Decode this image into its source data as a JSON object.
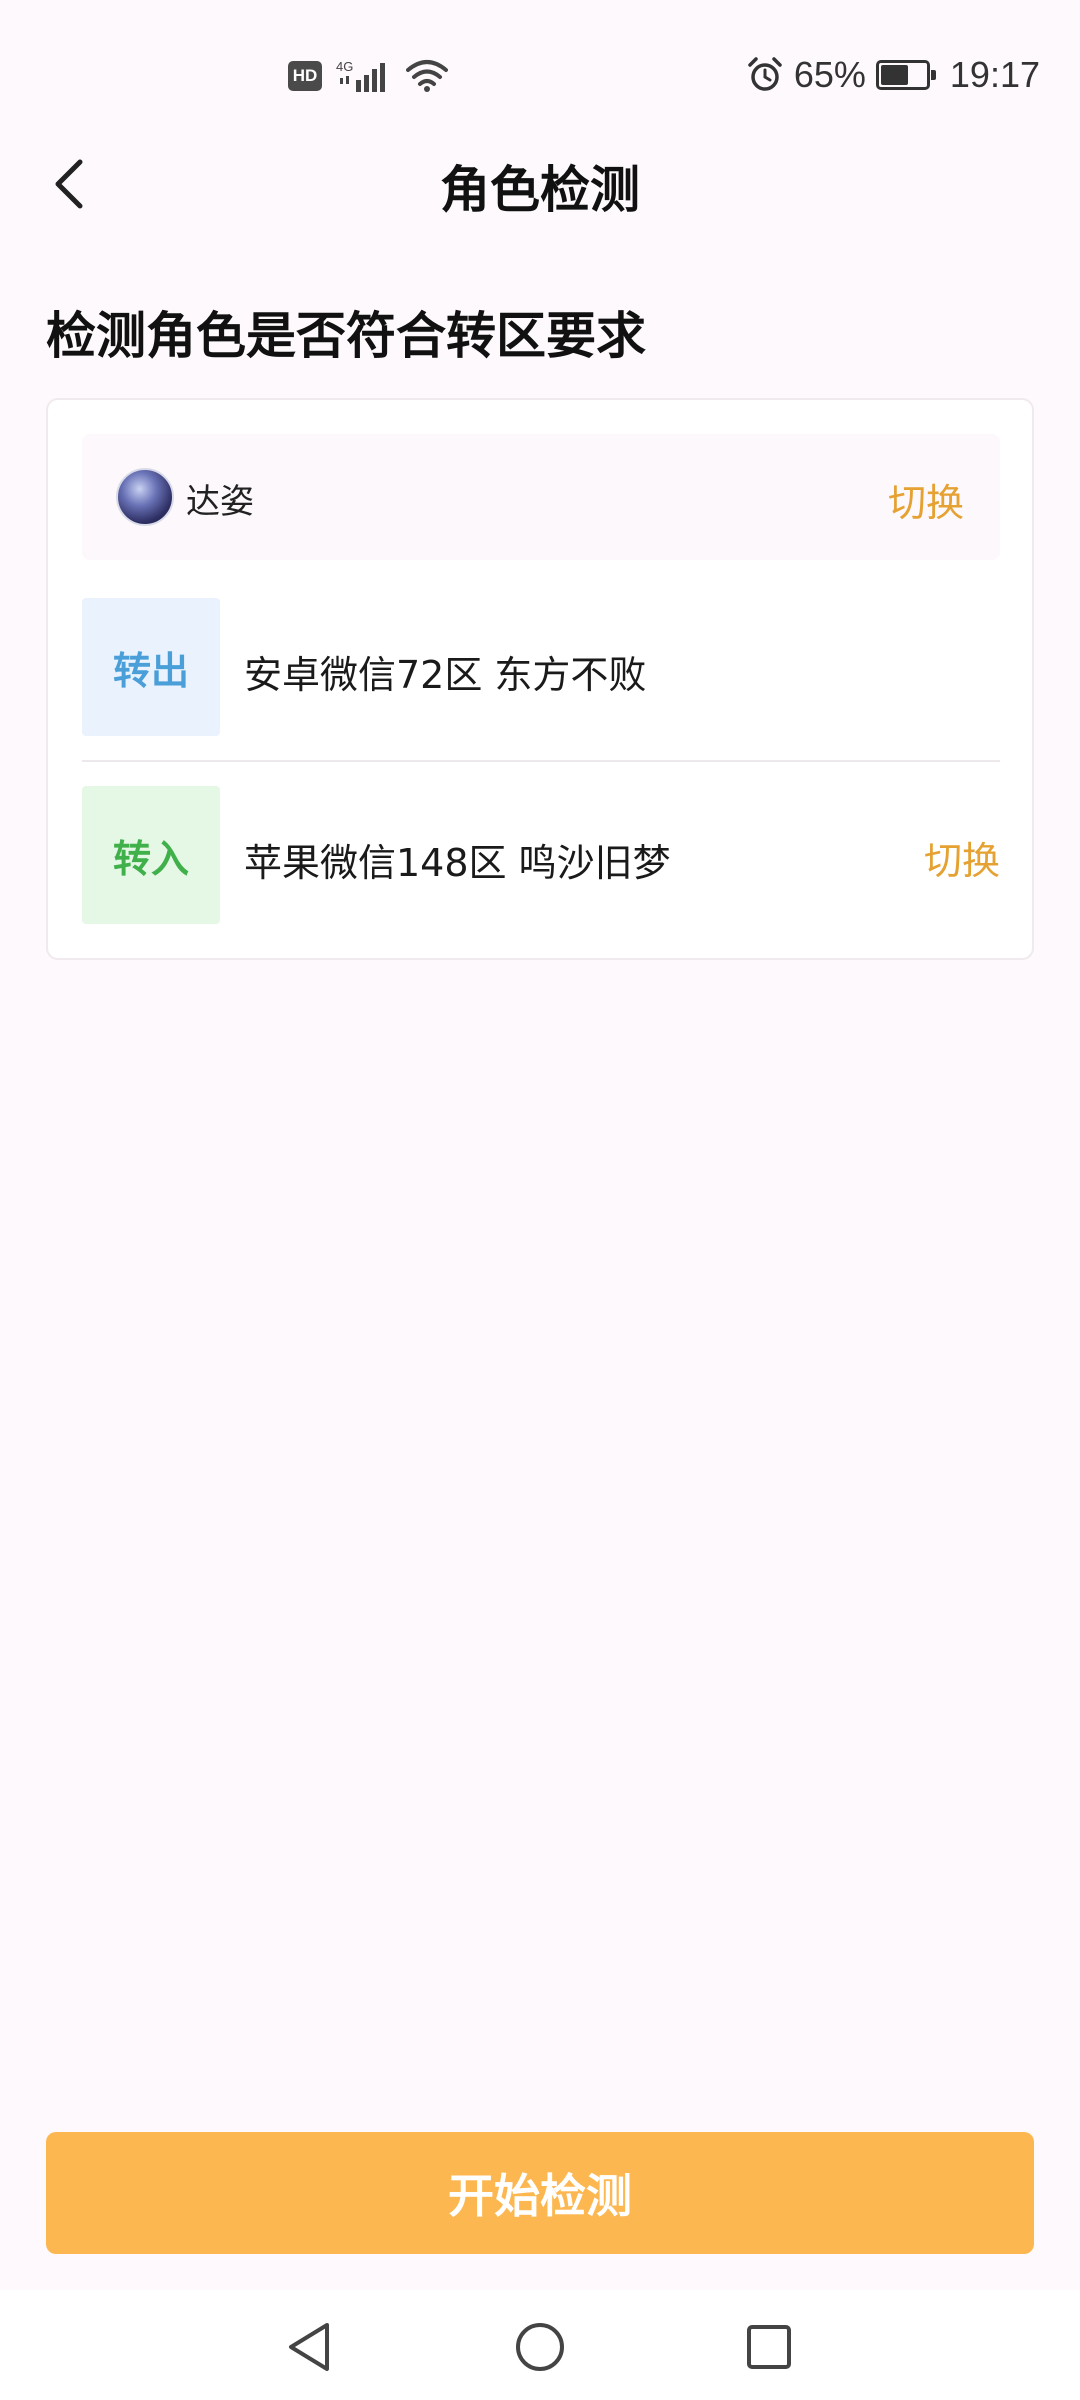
{
  "status_bar": {
    "hd_label": "HD",
    "network_label": "4G",
    "battery_percent": "65%",
    "battery_level": 0.65,
    "time": "19:17",
    "icons": [
      "hd-icon",
      "signal-icon",
      "wifi-icon",
      "alarm-icon",
      "battery-icon"
    ]
  },
  "header": {
    "title": "角色检测",
    "back_icon": "chevron-left-icon"
  },
  "section": {
    "title": "检测角色是否符合转区要求"
  },
  "role": {
    "name": "达姿",
    "switch_label": "切换"
  },
  "transfer_out": {
    "tag": "转出",
    "server": "安卓微信72区 东方不败",
    "tag_color": "#4b9fd8",
    "tag_bg": "#eaf2fe"
  },
  "transfer_in": {
    "tag": "转入",
    "server": "苹果微信148区 鸣沙旧梦",
    "switch_label": "切换",
    "tag_color": "#3fb04a",
    "tag_bg": "#e5f8e6"
  },
  "start_button": {
    "label": "开始检测",
    "color": "#fdb751"
  },
  "accent_color": "#e5a233",
  "nav_bar": {
    "icons": [
      "back-triangle-icon",
      "home-circle-icon",
      "recent-square-icon"
    ]
  }
}
